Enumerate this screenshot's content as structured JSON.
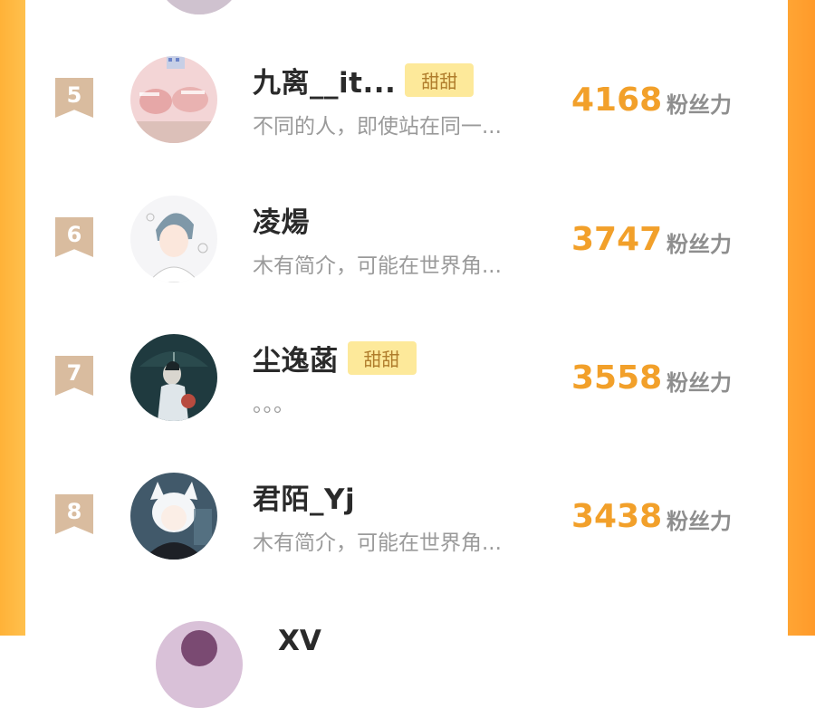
{
  "colors": {
    "background_edge": "#ffb238",
    "score": "#f2a02a",
    "rank_badge": "#d9bc9f",
    "tag_bg": "#fde99a",
    "tag_text": "#b07d2c"
  },
  "ranking": {
    "score_unit": "粉丝力",
    "rows": [
      {
        "rank": "5",
        "name": "九离__it...",
        "tag": "甜甜",
        "bio": "不同的人，即使站在同一...",
        "score": "4168",
        "avatar_icon": "hands-photo-avatar"
      },
      {
        "rank": "6",
        "name": "凌煬",
        "tag": "",
        "bio": "木有简介，可能在世界角...",
        "score": "3747",
        "avatar_icon": "anime-boy-avatar"
      },
      {
        "rank": "7",
        "name": "尘逸菡",
        "tag": "甜甜",
        "bio": "。。。",
        "score": "3558",
        "avatar_icon": "umbrella-boy-avatar"
      },
      {
        "rank": "8",
        "name": "君陌_Yj",
        "tag": "",
        "bio": "木有简介，可能在世界角...",
        "score": "3438",
        "avatar_icon": "white-cat-boy-avatar"
      }
    ],
    "partial_next_name": "XV"
  }
}
